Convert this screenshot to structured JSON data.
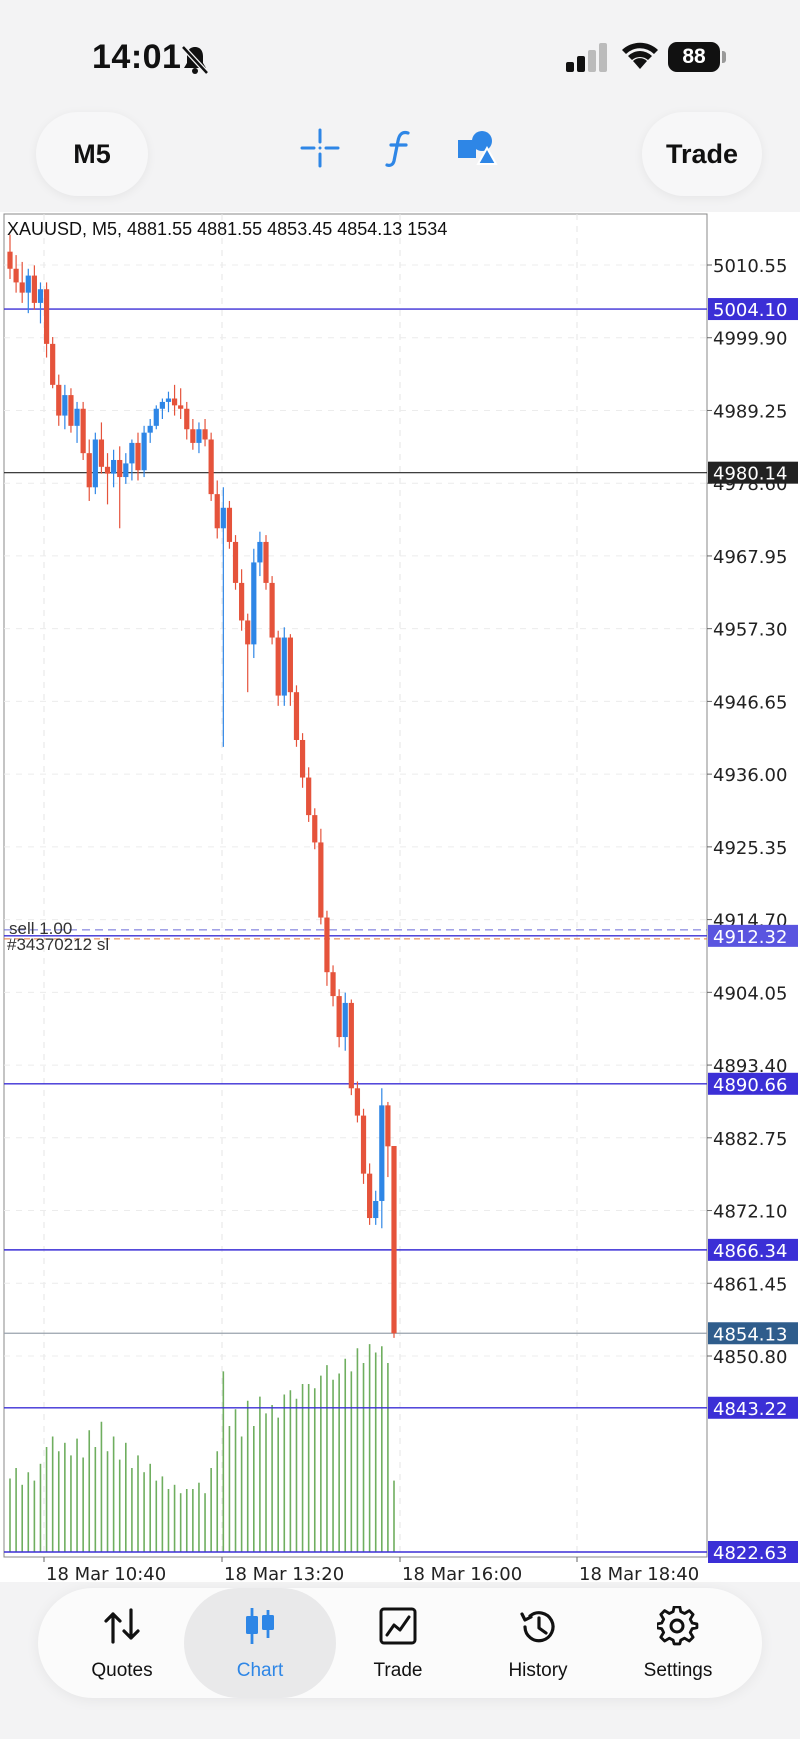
{
  "status": {
    "time": "14:01",
    "battery": "88"
  },
  "toolbar": {
    "timeframe": "M5",
    "trade_label": "Trade"
  },
  "chart": {
    "header": "XAUUSD, M5, 4881.55 4881.55 4853.45 4854.13 1534",
    "price_ticks": [
      "5010.55",
      "4999.90",
      "4989.25",
      "4978.60",
      "4967.95",
      "4957.30",
      "4946.65",
      "4936.00",
      "4925.35",
      "4914.70",
      "4904.05",
      "4893.40",
      "4882.75",
      "4872.10",
      "4861.45",
      "4850.80"
    ],
    "time_ticks": [
      "18 Mar 10:40",
      "18 Mar 13:20",
      "18 Mar 16:00",
      "18 Mar 18:40"
    ],
    "order_label_1": "sell 1.00",
    "order_label_2": "#34370212 sl",
    "line_labels": [
      "5004.10",
      "4980.14",
      "4912.32",
      "4890.66",
      "4866.34",
      "4854.13",
      "4843.22",
      "4822.63"
    ],
    "colors": {
      "bull": "#2e86e6",
      "bear": "#e5533b",
      "hline": "#3b2fd6",
      "volume": "#6fae5f",
      "bid": "#2f5d8c"
    }
  },
  "chart_data": {
    "type": "candlestick",
    "symbol": "XAUUSD",
    "timeframe": "M5",
    "title": "XAUUSD, M5, 4881.55 4881.55 4853.45 4854.13 1534",
    "ylim": [
      4847.0,
      5014.0
    ],
    "x_ticks": [
      "18 Mar 10:40",
      "18 Mar 13:20",
      "18 Mar 16:00",
      "18 Mar 18:40"
    ],
    "candles": [
      {
        "o": 5012.5,
        "h": 5015.0,
        "l": 5008.5,
        "c": 5010.0
      },
      {
        "o": 5010.0,
        "h": 5012.0,
        "l": 5006.5,
        "c": 5008.0
      },
      {
        "o": 5008.0,
        "h": 5011.0,
        "l": 5005.0,
        "c": 5006.5
      },
      {
        "o": 5006.5,
        "h": 5010.0,
        "l": 5003.5,
        "c": 5009.0
      },
      {
        "o": 5009.0,
        "h": 5010.5,
        "l": 5004.0,
        "c": 5005.0
      },
      {
        "o": 5005.0,
        "h": 5008.0,
        "l": 5002.0,
        "c": 5007.0
      },
      {
        "o": 5007.0,
        "h": 5008.0,
        "l": 4997.0,
        "c": 4999.0
      },
      {
        "o": 4999.0,
        "h": 5000.0,
        "l": 4992.5,
        "c": 4993.0
      },
      {
        "o": 4993.0,
        "h": 4994.5,
        "l": 4987.0,
        "c": 4988.5
      },
      {
        "o": 4988.5,
        "h": 4993.0,
        "l": 4986.5,
        "c": 4991.5
      },
      {
        "o": 4991.5,
        "h": 4992.5,
        "l": 4986.0,
        "c": 4987.0
      },
      {
        "o": 4987.0,
        "h": 4990.5,
        "l": 4984.5,
        "c": 4989.5
      },
      {
        "o": 4989.5,
        "h": 4990.5,
        "l": 4982.0,
        "c": 4983.0
      },
      {
        "o": 4983.0,
        "h": 4985.0,
        "l": 4976.0,
        "c": 4978.0
      },
      {
        "o": 4978.0,
        "h": 4986.0,
        "l": 4977.0,
        "c": 4985.0
      },
      {
        "o": 4985.0,
        "h": 4987.5,
        "l": 4980.0,
        "c": 4981.0
      },
      {
        "o": 4981.0,
        "h": 4983.0,
        "l": 4975.5,
        "c": 4980.0
      },
      {
        "o": 4980.0,
        "h": 4983.5,
        "l": 4978.0,
        "c": 4982.0
      },
      {
        "o": 4982.0,
        "h": 4984.0,
        "l": 4972.0,
        "c": 4979.5
      },
      {
        "o": 4979.5,
        "h": 4983.0,
        "l": 4978.5,
        "c": 4981.5
      },
      {
        "o": 4981.5,
        "h": 4985.0,
        "l": 4979.0,
        "c": 4984.5
      },
      {
        "o": 4984.5,
        "h": 4986.0,
        "l": 4979.0,
        "c": 4980.5
      },
      {
        "o": 4980.5,
        "h": 4987.0,
        "l": 4979.5,
        "c": 4986.0
      },
      {
        "o": 4986.0,
        "h": 4988.0,
        "l": 4984.5,
        "c": 4987.0
      },
      {
        "o": 4987.0,
        "h": 4990.0,
        "l": 4986.5,
        "c": 4989.5
      },
      {
        "o": 4989.5,
        "h": 4991.0,
        "l": 4988.0,
        "c": 4990.5
      },
      {
        "o": 4990.5,
        "h": 4992.0,
        "l": 4989.0,
        "c": 4991.0
      },
      {
        "o": 4991.0,
        "h": 4993.0,
        "l": 4988.5,
        "c": 4990.0
      },
      {
        "o": 4990.0,
        "h": 4992.5,
        "l": 4988.0,
        "c": 4989.5
      },
      {
        "o": 4989.5,
        "h": 4990.5,
        "l": 4985.0,
        "c": 4986.5
      },
      {
        "o": 4986.5,
        "h": 4988.0,
        "l": 4983.5,
        "c": 4984.5
      },
      {
        "o": 4984.5,
        "h": 4987.5,
        "l": 4983.0,
        "c": 4986.5
      },
      {
        "o": 4986.5,
        "h": 4988.0,
        "l": 4984.0,
        "c": 4985.0
      },
      {
        "o": 4985.0,
        "h": 4986.0,
        "l": 4976.0,
        "c": 4977.0
      },
      {
        "o": 4977.0,
        "h": 4979.0,
        "l": 4970.5,
        "c": 4972.0
      },
      {
        "o": 4972.0,
        "h": 4978.0,
        "l": 4940.0,
        "c": 4975.0
      },
      {
        "o": 4975.0,
        "h": 4976.0,
        "l": 4969.0,
        "c": 4970.0
      },
      {
        "o": 4970.0,
        "h": 4971.0,
        "l": 4963.0,
        "c": 4964.0
      },
      {
        "o": 4964.0,
        "h": 4966.0,
        "l": 4957.0,
        "c": 4958.5
      },
      {
        "o": 4958.5,
        "h": 4959.5,
        "l": 4948.0,
        "c": 4955.0
      },
      {
        "o": 4955.0,
        "h": 4969.0,
        "l": 4953.0,
        "c": 4967.0
      },
      {
        "o": 4967.0,
        "h": 4971.5,
        "l": 4965.0,
        "c": 4970.0
      },
      {
        "o": 4970.0,
        "h": 4971.0,
        "l": 4963.0,
        "c": 4964.0
      },
      {
        "o": 4964.0,
        "h": 4965.0,
        "l": 4955.0,
        "c": 4956.0
      },
      {
        "o": 4956.0,
        "h": 4957.0,
        "l": 4946.0,
        "c": 4947.5
      },
      {
        "o": 4947.5,
        "h": 4957.5,
        "l": 4946.0,
        "c": 4956.0
      },
      {
        "o": 4956.0,
        "h": 4956.5,
        "l": 4946.0,
        "c": 4948.0
      },
      {
        "o": 4948.0,
        "h": 4949.0,
        "l": 4940.0,
        "c": 4941.0
      },
      {
        "o": 4941.0,
        "h": 4942.0,
        "l": 4934.0,
        "c": 4935.5
      },
      {
        "o": 4935.5,
        "h": 4937.0,
        "l": 4929.0,
        "c": 4930.0
      },
      {
        "o": 4930.0,
        "h": 4931.0,
        "l": 4925.0,
        "c": 4926.0
      },
      {
        "o": 4926.0,
        "h": 4928.0,
        "l": 4914.0,
        "c": 4915.0
      },
      {
        "o": 4915.0,
        "h": 4916.0,
        "l": 4905.0,
        "c": 4907.0
      },
      {
        "o": 4907.0,
        "h": 4908.0,
        "l": 4902.0,
        "c": 4903.5
      },
      {
        "o": 4903.5,
        "h": 4904.5,
        "l": 4896.0,
        "c": 4897.5
      },
      {
        "o": 4897.5,
        "h": 4904.0,
        "l": 4895.5,
        "c": 4902.5
      },
      {
        "o": 4902.5,
        "h": 4903.0,
        "l": 4889.0,
        "c": 4890.0
      },
      {
        "o": 4890.0,
        "h": 4891.0,
        "l": 4885.0,
        "c": 4886.0
      },
      {
        "o": 4886.0,
        "h": 4887.0,
        "l": 4876.0,
        "c": 4877.5
      },
      {
        "o": 4877.5,
        "h": 4879.0,
        "l": 4870.0,
        "c": 4871.0
      },
      {
        "o": 4871.0,
        "h": 4875.0,
        "l": 4870.0,
        "c": 4873.5
      },
      {
        "o": 4873.5,
        "h": 4890.0,
        "l": 4869.5,
        "c": 4887.5
      },
      {
        "o": 4887.5,
        "h": 4888.0,
        "l": 4877.0,
        "c": 4881.5
      },
      {
        "o": 4881.55,
        "h": 4881.55,
        "l": 4853.45,
        "c": 4854.13
      }
    ],
    "volume": [
      0.35,
      0.4,
      0.32,
      0.38,
      0.34,
      0.42,
      0.5,
      0.55,
      0.48,
      0.52,
      0.46,
      0.54,
      0.45,
      0.58,
      0.5,
      0.62,
      0.48,
      0.55,
      0.44,
      0.52,
      0.4,
      0.46,
      0.38,
      0.42,
      0.34,
      0.36,
      0.3,
      0.32,
      0.28,
      0.3,
      0.3,
      0.33,
      0.28,
      0.4,
      0.48,
      0.86,
      0.6,
      0.68,
      0.55,
      0.72,
      0.6,
      0.74,
      0.66,
      0.7,
      0.64,
      0.75,
      0.77,
      0.73,
      0.8,
      0.8,
      0.78,
      0.84,
      0.89,
      0.82,
      0.85,
      0.92,
      0.86,
      0.97,
      0.9,
      0.99,
      0.95,
      0.98,
      0.9,
      0.34
    ],
    "horizontal_levels": [
      5004.1,
      4980.14,
      4912.32,
      4890.66,
      4866.34,
      4854.13,
      4843.22,
      4822.63
    ]
  }
}
